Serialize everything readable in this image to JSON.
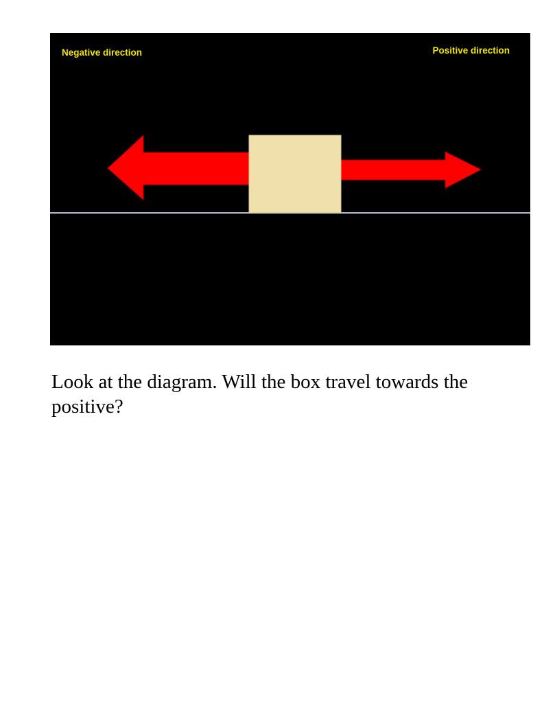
{
  "diagram": {
    "negative_label": "Negative direction",
    "positive_label": "Positive direction",
    "label_color": "#f2e600",
    "background_color": "#000000",
    "arrow_color": "#ff0000",
    "box_color": "#efe0ac",
    "ground_color": "#b8bcd8"
  },
  "question": {
    "text": "Look at the diagram. Will the box travel towards the positive?"
  }
}
